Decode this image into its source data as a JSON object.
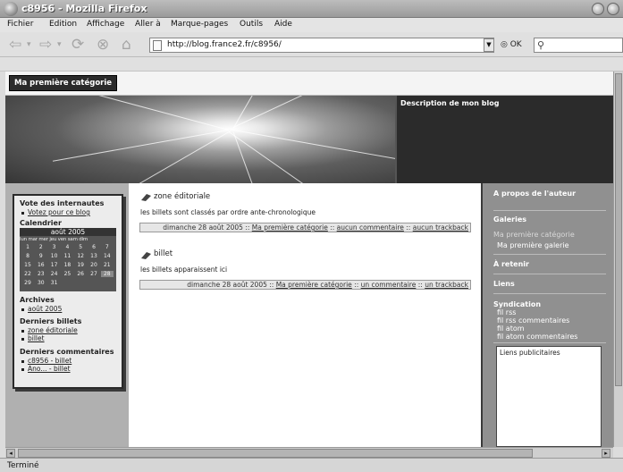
{
  "window": {
    "title": "c8956 - Mozilla Firefox"
  },
  "menu": [
    "Fichier",
    "Edition",
    "Affichage",
    "Aller à",
    "Marque-pages",
    "Outils",
    "Aide"
  ],
  "nav": {
    "url": "http://blog.france2.fr/c8956/",
    "go_label": "OK",
    "back_icon": "back-arrow-icon",
    "forward_icon": "forward-arrow-icon",
    "reload_icon": "reload-icon",
    "stop_icon": "stop-icon",
    "home_icon": "home-icon"
  },
  "blog": {
    "category_button": "Ma première catégorie",
    "description": "Description de mon blog"
  },
  "left": {
    "vote_heading": "Vote des internautes",
    "vote_link": "Votez pour ce blog",
    "calendar_heading": "Calendrier",
    "calendar_month": "août 2005",
    "calendar_days": "lun mar mer jeu ven sam dim",
    "calendar_rows": [
      [
        "1",
        "2",
        "3",
        "4",
        "5",
        "6",
        "7"
      ],
      [
        "8",
        "9",
        "10",
        "11",
        "12",
        "13",
        "14"
      ],
      [
        "15",
        "16",
        "17",
        "18",
        "19",
        "20",
        "21"
      ],
      [
        "22",
        "23",
        "24",
        "25",
        "26",
        "27",
        "28"
      ],
      [
        "29",
        "30",
        "31"
      ]
    ],
    "archives_heading": "Archives",
    "archives_link": "août 2005",
    "last_posts_heading": "Derniers billets",
    "last_posts": [
      "zone éditoriale",
      "billet"
    ],
    "last_comments_heading": "Derniers commentaires",
    "last_comments": [
      "c8956 - billet",
      "Ano... - billet"
    ]
  },
  "posts": [
    {
      "title": "zone éditoriale",
      "body": "les billets sont classés par ordre ante-chronologique",
      "date": "dimanche 28 août 2005",
      "sep": " :: ",
      "category": "Ma première catégorie",
      "comments": "aucun commentaire",
      "trackback": "aucun trackback"
    },
    {
      "title": "billet",
      "body": "les billets apparaissent ici",
      "date": "dimanche 28 août 2005",
      "sep": " :: ",
      "category": "Ma première catégorie",
      "comments": "un commentaire",
      "trackback": "un trackback"
    }
  ],
  "right": {
    "about": "A propos de l'auteur",
    "galleries": "Galeries",
    "gallery_category": "Ma première catégorie",
    "gallery_item": "Ma première galerie",
    "retain": "À retenir",
    "links": "Liens",
    "syndication": "Syndication",
    "feeds": [
      "fil rss",
      "fil rss commentaires",
      "fil atom",
      "fil atom commentaires"
    ],
    "ads": "Liens publicitaires"
  },
  "status": "Terminé",
  "colors": {
    "sidebar": "#909090",
    "header_dark": "#2b2b2b",
    "page_bg": "#ffffff"
  }
}
